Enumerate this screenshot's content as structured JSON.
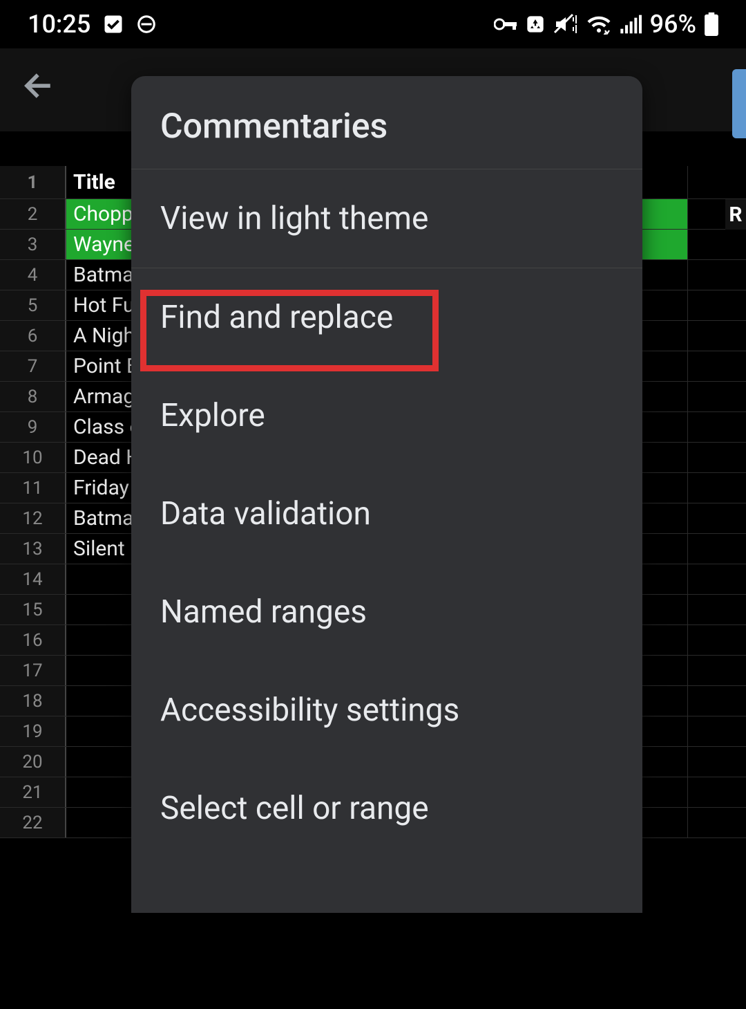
{
  "status": {
    "time": "10:25",
    "battery_percent": "96%"
  },
  "sheet": {
    "columnA_header": "Title",
    "col_right_label": "R",
    "rows": [
      {
        "n": "1",
        "a": "Title",
        "header": true
      },
      {
        "n": "2",
        "a": "Choppi",
        "green": true
      },
      {
        "n": "3",
        "a": "Wayne",
        "green": true
      },
      {
        "n": "4",
        "a": "Batma"
      },
      {
        "n": "5",
        "a": "Hot Fu"
      },
      {
        "n": "6",
        "a": "A Nigh"
      },
      {
        "n": "7",
        "a": "Point B"
      },
      {
        "n": "8",
        "a": "Armag"
      },
      {
        "n": "9",
        "a": "Class o"
      },
      {
        "n": "10",
        "a": "Dead H"
      },
      {
        "n": "11",
        "a": "Friday"
      },
      {
        "n": "12",
        "a": "Batma"
      },
      {
        "n": "13",
        "a": "Silent I"
      },
      {
        "n": "14",
        "a": ""
      },
      {
        "n": "15",
        "a": ""
      },
      {
        "n": "16",
        "a": ""
      },
      {
        "n": "17",
        "a": ""
      },
      {
        "n": "18",
        "a": ""
      },
      {
        "n": "19",
        "a": ""
      },
      {
        "n": "20",
        "a": ""
      },
      {
        "n": "21",
        "a": ""
      },
      {
        "n": "22",
        "a": ""
      }
    ]
  },
  "menu": {
    "title": "Commentaries",
    "items": [
      "View in light theme",
      "Find and replace",
      "Explore",
      "Data validation",
      "Named ranges",
      "Accessibility settings",
      "Select cell or range"
    ]
  }
}
